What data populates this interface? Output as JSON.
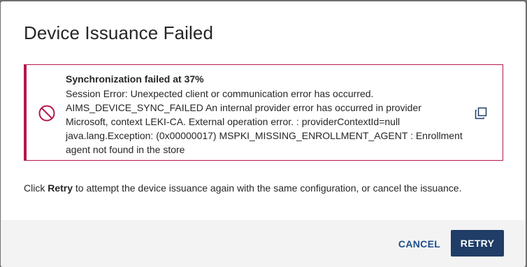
{
  "dialog": {
    "title": "Device Issuance Failed"
  },
  "alert": {
    "icon": "prohibited-icon",
    "heading": "Synchronization failed at 37%",
    "lines": [
      "Session Error: Unexpected client or communication error has occurred.",
      "AIMS_DEVICE_SYNC_FAILED An internal provider error has occurred in provider",
      "Microsoft, context LEKI-CA. External operation error. : providerContextId=null",
      "java.lang.Exception: (0x00000017) MSPKI_MISSING_ENROLLMENT_AGENT : Enrollment",
      "agent not found in the store"
    ],
    "copy_icon": "copy-icon",
    "accent_color": "#b5174a"
  },
  "instruction": {
    "prefix": "Click ",
    "emphasis": "Retry",
    "suffix": " to attempt the device issuance again with the same configuration, or cancel the issuance."
  },
  "footer": {
    "cancel_label": "CANCEL",
    "retry_label": "RETRY",
    "primary_color": "#1f3d66"
  }
}
